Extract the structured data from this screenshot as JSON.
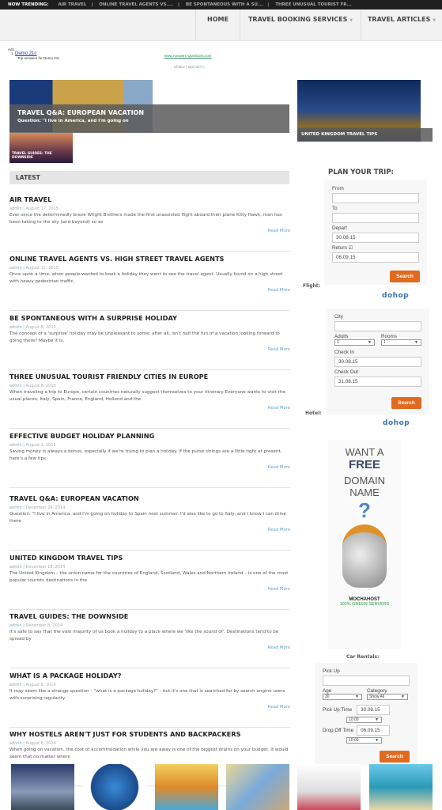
{
  "trending": {
    "label": "NOW TRENDING:",
    "items": [
      "AIR TRAVEL",
      "ONLINE TRAVEL AGENTS VS....",
      "BE SPONTANEOUS WITH A SU...",
      "THREE UNUSUAL TOURIST FR..."
    ]
  },
  "nav": {
    "items": [
      "HOME",
      "TRAVEL BOOKING SERVICES",
      "TRAVEL ARTICLES"
    ]
  },
  "ads": {
    "label": "Ads",
    "link": "Demo 21c",
    "desc": "Top answers for Demo 21c",
    "url": "www.Answers-Questions.com",
    "adchoices": "Choice | Opt out?"
  },
  "featured": {
    "main_title": "TRAVEL Q&A: EUROPEAN VACATION",
    "main_excerpt": "Question: \"I live in America, and I'm going on",
    "side_title": "UNITED KINGDOM TRAVEL TIPS",
    "small_title": "TRAVEL GUIDES: THE DOWNSIDE"
  },
  "latest_label": "LATEST",
  "read_more": "Read More",
  "posts": [
    {
      "title": "AIR TRAVEL",
      "author": "admin",
      "date": "August 17, 2015",
      "excerpt": "Ever since the determinedly brave Wright Brothers made the first unassisted flight aboard their plane Kitty Hawk, man has been taking to the sky (and beyond) so as"
    },
    {
      "title": "ONLINE TRAVEL AGENTS VS. HIGH STREET TRAVEL AGENTS",
      "author": "admin",
      "date": "August 12, 2015",
      "excerpt": "Once upon a time, when people wanted to book a holiday they went to see the travel agent. Usually found on a high street with heavy pedestrian traffic,"
    },
    {
      "title": "BE SPONTANEOUS WITH A SURPRISE HOLIDAY",
      "author": "admin",
      "date": "August 8, 2015",
      "excerpt": "The concept of a 'surprise' holiday may be unpleasant to some; after all, isn't half the fun of a vacation looking forward to going there? Maybe it is,"
    },
    {
      "title": "THREE UNUSUAL TOURIST FRIENDLY CITIES IN EUROPE",
      "author": "admin",
      "date": "August 8, 2015",
      "excerpt": "When traveling a trip to Europe, certain countries naturally suggest themselves to your itinerary Everyone wants to visit the usual places; Italy, Spain, France, England, Holland and the"
    },
    {
      "title": "EFFECTIVE BUDGET HOLIDAY PLANNING",
      "author": "admin",
      "date": "August 1, 2015",
      "excerpt": "Saving money is always a bonus, especially if we're trying to plan a holiday. If the purse strings are a little tight at present, here's a few tips"
    },
    {
      "title": "TRAVEL Q&A: EUROPEAN VACATION",
      "author": "admin",
      "date": "December 24, 2014",
      "excerpt": "Question: \"I live in America, and I'm going on holiday to Spain next summer. I'd also like to go to Italy, and I know I can drive there"
    },
    {
      "title": "UNITED KINGDOM TRAVEL TIPS",
      "author": "admin",
      "date": "December 18, 2014",
      "excerpt": "The United Kingdom – the union name for the countries of England, Scotland, Wales and Northern Ireland – is one of the most popular tourists destinations in the"
    },
    {
      "title": "TRAVEL GUIDES: THE DOWNSIDE",
      "author": "admin",
      "date": "December 8, 2014",
      "excerpt": "It's safe to say that the vast majority of us book a holiday to a place where we 'like the sound of'. Destinations tend to be spread by"
    },
    {
      "title": "WHAT IS A PACKAGE HOLIDAY?",
      "author": "admin",
      "date": "August 8, 2014",
      "excerpt": "It may seem like a strange question – \"what is a package holiday?\" – but it's one that is searched for by search engine users with surprising regularity."
    },
    {
      "title": "WHY HOSTELS AREN'T JUST FOR STUDENTS AND BACKPACKERS",
      "author": "admin",
      "date": "August 8, 2014",
      "excerpt": "When going on vacation, the cost of accommodation while you are away is one of the biggest drains on your budget. It would seem that no matter where"
    }
  ],
  "sidebar": {
    "plan_title": "PLAN YOUR TRIP:",
    "flight": {
      "label": "Flight:",
      "from_label": "From",
      "from_value": "",
      "to_label": "To",
      "to_value": "",
      "depart_label": "Depart",
      "depart_value": "30.08.15",
      "return_label": "Return",
      "return_checked": true,
      "return_value": "06.09.15",
      "search": "Search",
      "powered": "dohop"
    },
    "hotel": {
      "label": "Hotel:",
      "city_label": "City",
      "city_value": "",
      "adults_label": "Adults",
      "adults_value": "1",
      "rooms_label": "Rooms",
      "rooms_value": "1",
      "checkin_label": "Check In",
      "checkin_value": "30.08.15",
      "checkout_label": "Check Out",
      "checkout_value": "31.08.15",
      "search": "Search",
      "powered": "dohop"
    },
    "ad": {
      "line1": "WANT A",
      "line2": "FREE",
      "line3": "DOMAIN",
      "line4": "NAME",
      "brand": "MOCHAHOST",
      "tag": "100% GREEN SERVERS"
    },
    "car": {
      "label": "Car Rentals:",
      "pickup_label": "Pick Up",
      "pickup_value": "",
      "age_label": "Age",
      "age_value": "30",
      "category_label": "Category",
      "category_value": "Show All",
      "pickup_time_label": "Pick Up Time",
      "pickup_date": "30.08.15",
      "pickup_time": "10:00",
      "dropoff_time_label": "Drop Off Time",
      "dropoff_date": "06.09.15",
      "dropoff_time": "10:00",
      "search": "Search"
    }
  },
  "colors": {
    "accent": "#e06a1f",
    "link": "#6a9fc7",
    "topbar": "#1e1e1e"
  }
}
